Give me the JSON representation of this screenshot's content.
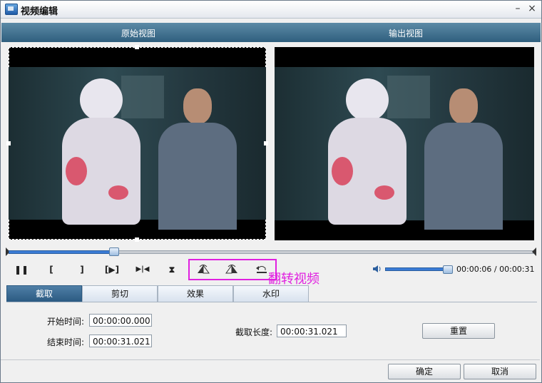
{
  "window": {
    "title": "视频编辑",
    "close_glyph": "×"
  },
  "views": {
    "original_label": "原始视图",
    "output_label": "输出视图"
  },
  "timeline": {
    "progress_fraction": 0.2
  },
  "controls": {
    "pause": "❚❚",
    "mark_in": "[",
    "mark_out": "]",
    "play_segment": "[▶]",
    "next_frame": "▶|◀",
    "split": "⧗",
    "annotation": "翻转视频"
  },
  "volume": {
    "level_fraction": 0.95
  },
  "time": {
    "current": "00:00:06",
    "separator": " / ",
    "total": "00:00:31"
  },
  "tabs": [
    {
      "label": "截取",
      "active": true
    },
    {
      "label": "剪切",
      "active": false
    },
    {
      "label": "效果",
      "active": false
    },
    {
      "label": "水印",
      "active": false
    }
  ],
  "trim": {
    "start_label": "开始时间:",
    "start_value": "00:00:00.000",
    "end_label": "结束时间:",
    "end_value": "00:00:31.021",
    "length_label": "截取长度:",
    "length_value": "00:00:31.021",
    "reset_label": "重置"
  },
  "footer": {
    "ok_label": "确定",
    "cancel_label": "取消"
  },
  "colors": {
    "accent": "#2b5a82",
    "annotation": "#e020e0",
    "progress": "#3a7bd5"
  }
}
